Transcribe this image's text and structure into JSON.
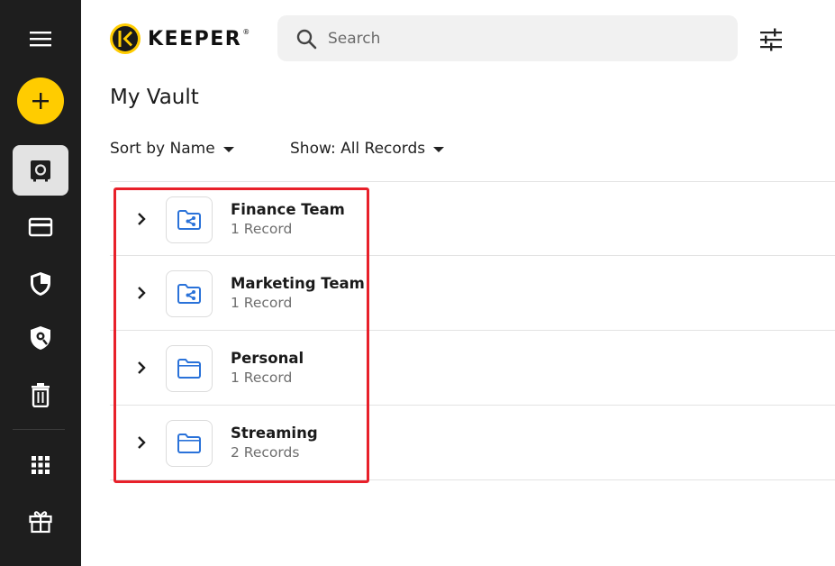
{
  "header": {
    "logo_text": "KEEPER",
    "logo_mark": "®",
    "search_placeholder": "Search"
  },
  "sidebar": {
    "items": [
      {
        "name": "menu",
        "icon": "hamburger-icon"
      },
      {
        "name": "create",
        "icon": "plus-icon"
      },
      {
        "name": "vault",
        "icon": "vault-icon",
        "active": true
      },
      {
        "name": "payment-cards",
        "icon": "card-icon"
      },
      {
        "name": "security-audit",
        "icon": "shield-icon"
      },
      {
        "name": "breachwatch",
        "icon": "shield-eye-icon"
      },
      {
        "name": "deleted-items",
        "icon": "trash-icon"
      },
      {
        "name": "apps",
        "icon": "grid-icon"
      },
      {
        "name": "gift",
        "icon": "gift-icon"
      }
    ]
  },
  "main": {
    "title": "My Vault",
    "sort_label": "Sort by Name",
    "show_label": "Show: All Records"
  },
  "folders": [
    {
      "name": "Finance Team",
      "count": "1 Record",
      "icon": "shared-folder-icon"
    },
    {
      "name": "Marketing Team",
      "count": "1 Record",
      "icon": "shared-folder-icon"
    },
    {
      "name": "Personal",
      "count": "1 Record",
      "icon": "folder-icon"
    },
    {
      "name": "Streaming",
      "count": "2 Records",
      "icon": "folder-icon"
    }
  ],
  "colors": {
    "sidebar_bg": "#1e1e1e",
    "accent_yellow": "#ffcc00",
    "folder_blue": "#2a72d9",
    "highlight_red": "#e8202a"
  }
}
